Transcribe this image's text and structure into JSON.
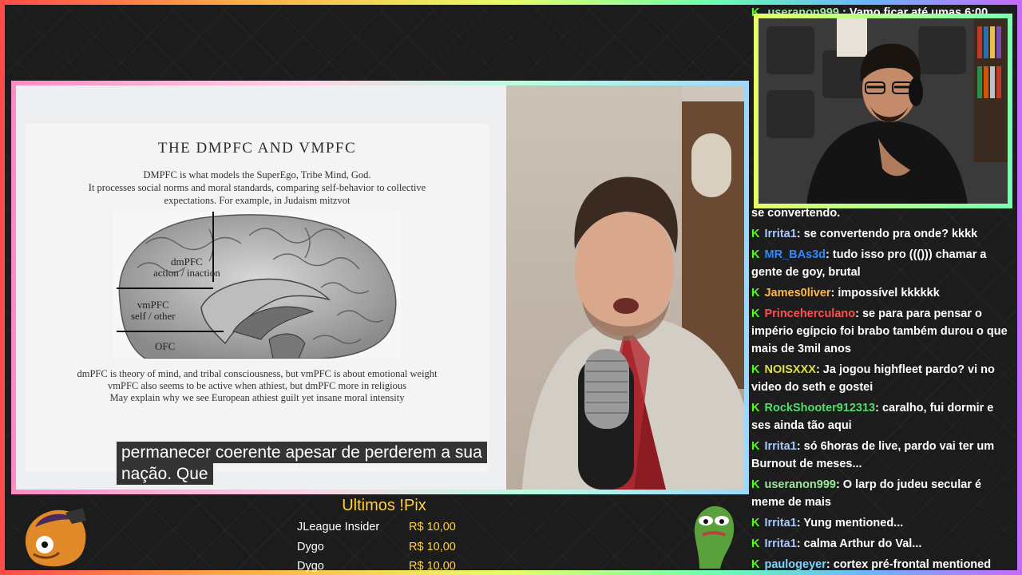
{
  "slide": {
    "title": "THE DMPFC AND VMPFC",
    "intro_1": "DMPFC is what models the SuperEgo, Tribe Mind, God.",
    "intro_2": "It processes social norms and moral standards, comparing self-behavior to collective",
    "intro_3": "expectations. For example, in Judaism mitzvot",
    "brain_labels": {
      "dmpfc": "dmPFC",
      "dmpfc_sub": "action / inaction",
      "vmpfc": "vmPFC",
      "vmpfc_sub": "self / other",
      "ofc": "OFC"
    },
    "note_1": "dmPFC is theory of mind, and tribal consciousness, but vmPFC is about emotional weight",
    "note_2": "vmPFC also seems to be active when athiest, but dmPFC more in religious",
    "note_3": "May explain why we see European athiest guilt yet insane moral intensity"
  },
  "subtitles": {
    "line_1": "permanecer coerente apesar de perderem a sua",
    "line_2": "nação. Que"
  },
  "chat_top": {
    "user": "useranon999",
    "text": ": Vamo ficar até umas 6:00"
  },
  "chat": {
    "partial": "se convertendo.",
    "messages": [
      {
        "user": "Irrita1",
        "color": "#a9c8ff",
        "text": ": se convertendo pra onde? kkkk"
      },
      {
        "user": "MR_BAs3d",
        "color": "#2e8bff",
        "text": ": tudo isso pro ((())) chamar a gente de goy, brutal"
      },
      {
        "user": "James0liver",
        "color": "#ffb84d",
        "text": ": impossível kkkkkk"
      },
      {
        "user": "Princeherculano",
        "color": "#ff5050",
        "text": ": se para para pensar o império egípcio foi brabo também durou o que mais de 3mil anos"
      },
      {
        "user": "NOISXXX",
        "color": "#d9e04a",
        "text": ": Ja jogou highfleet pardo? vi no video do seth e gostei"
      },
      {
        "user": "RockShooter912313",
        "color": "#4fe06a",
        "text": ": caralho, fui dormir e ses ainda tão aqui"
      },
      {
        "user": "Irrita1",
        "color": "#a9c8ff",
        "text": ": só 6horas de live, pardo vai ter um Burnout de meses..."
      },
      {
        "user": "useranon999",
        "color": "#9de69b",
        "text": ": O larp do judeu secular é meme de mais"
      },
      {
        "user": "Irrita1",
        "color": "#a9c8ff",
        "text": ": Yung mentioned..."
      },
      {
        "user": "Irrita1",
        "color": "#a9c8ff",
        "text": ": calma Arthur do Val..."
      },
      {
        "user": "paulogeyer",
        "color": "#7fd4ff",
        "text": ": cortex pré-frontal mentioned"
      }
    ]
  },
  "pix": {
    "title": "Ultimos !Pix",
    "rows": [
      {
        "name": "JLeague Insider",
        "amount": "R$ 10,00"
      },
      {
        "name": "Dygo",
        "amount": "R$ 10,00"
      },
      {
        "name": "Dygo",
        "amount": "R$ 10,00"
      }
    ]
  },
  "colors": {
    "kick_green": "#53fc18",
    "pix_yellow": "#ffd23c"
  }
}
